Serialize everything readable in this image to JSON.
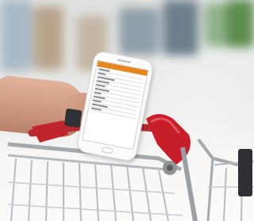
{
  "scene": {
    "subject": "smartphone",
    "colors": {
      "handle_red": "#c81e2a",
      "app_bar_orange": "#e5871e",
      "cart_metal": "#9aa0a4"
    }
  },
  "phone_screen": {
    "menu_rows": 11
  }
}
